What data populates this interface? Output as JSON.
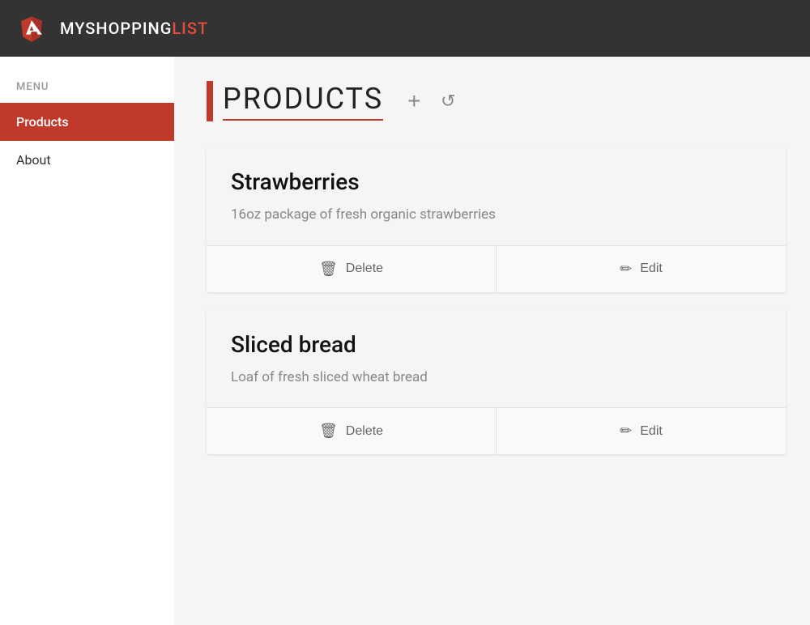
{
  "header": {
    "logo_letter": "A",
    "title_prefix": "MY",
    "title_middle": "SHOPPING",
    "title_highlight": "LIST"
  },
  "sidebar": {
    "menu_label": "MENU",
    "items": [
      {
        "id": "products",
        "label": "Products",
        "active": true
      },
      {
        "id": "about",
        "label": "About",
        "active": false
      }
    ]
  },
  "main": {
    "page_title": "PRODUCTS",
    "add_button_label": "+",
    "refresh_button_label": "↻",
    "products": [
      {
        "id": 1,
        "name": "Strawberries",
        "description": "16oz package of fresh organic strawberries",
        "delete_label": "Delete",
        "edit_label": "Edit"
      },
      {
        "id": 2,
        "name": "Sliced bread",
        "description": "Loaf of fresh sliced wheat bread",
        "delete_label": "Delete",
        "edit_label": "Edit"
      }
    ]
  },
  "colors": {
    "accent": "#c0392b",
    "header_bg": "#333333"
  }
}
